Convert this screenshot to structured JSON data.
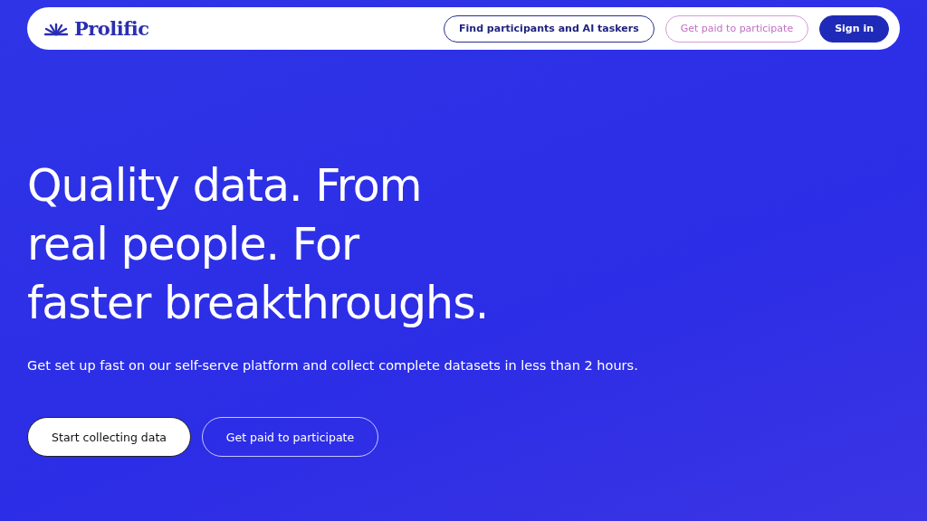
{
  "nav": {
    "brand": "Prolific",
    "links": [
      {
        "label": "Find participants and AI taskers",
        "kind": "outline"
      },
      {
        "label": "Get paid to participate",
        "kind": "pink"
      },
      {
        "label": "Sign in",
        "kind": "solid"
      }
    ]
  },
  "hero": {
    "headline_lines": [
      "Quality data. From",
      "real people. For",
      "faster breakthroughs."
    ],
    "subtitle": "Get set up fast on our self-serve platform and collect complete datasets in less than 2 hours.",
    "buttons": [
      {
        "label": "Start collecting data",
        "kind": "white"
      },
      {
        "label": "Get paid to participate",
        "kind": "ghost"
      }
    ]
  }
}
